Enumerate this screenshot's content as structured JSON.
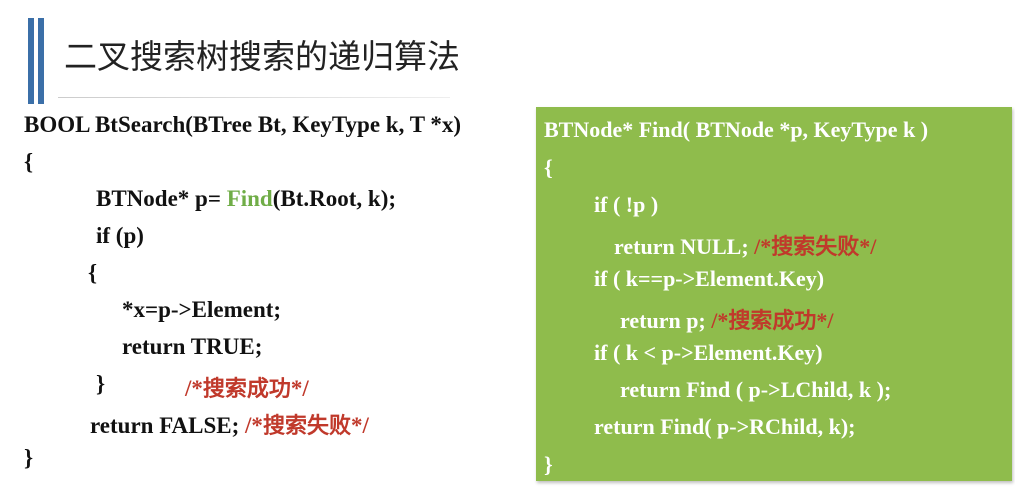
{
  "header": {
    "title": "二叉搜索树搜索的递归算法"
  },
  "left_code": {
    "l1": "BOOL BtSearch(BTree Bt, KeyType k, T *x)",
    "l2": "{",
    "l3_pre": "BTNode* p= ",
    "l3_func": "Find",
    "l3_post": "(Bt.Root, k);",
    "l4": "if (p)",
    "l5": "{",
    "l6": "*x=p->Element;",
    "l7": "return TRUE;",
    "l8": "}",
    "l8_comment_open": "/*",
    "l8_comment_text": "搜索成功",
    "l8_comment_close": "*/",
    "l9": "return FALSE;  ",
    "l9_comment_open": "/*",
    "l9_comment_text": "搜索失败",
    "l9_comment_close": "*/",
    "l10": "}"
  },
  "right_code": {
    "l1": "BTNode* Find( BTNode *p, KeyType k )",
    "l2": "{",
    "l3": "if ( !p )",
    "l4": "return NULL;  ",
    "l4_comment_open": "/*",
    "l4_comment_text": "搜索失败",
    "l4_comment_close": "*/",
    "l5": "if ( k==p->Element.Key)",
    "l6": "return p;  ",
    "l6_comment_open": "/*",
    "l6_comment_text": "搜索成功",
    "l6_comment_close": "*/",
    "l7": "if ( k <  p->Element.Key)",
    "l8": "return Find ( p->LChild, k );",
    "l9": "return Find( p->RChild, k);",
    "l10": "}"
  },
  "colors": {
    "accent_bar": "#3b6fa8",
    "box_background": "#8fbc4c",
    "comment": "#c0392b",
    "function_highlight": "#70ad47"
  }
}
